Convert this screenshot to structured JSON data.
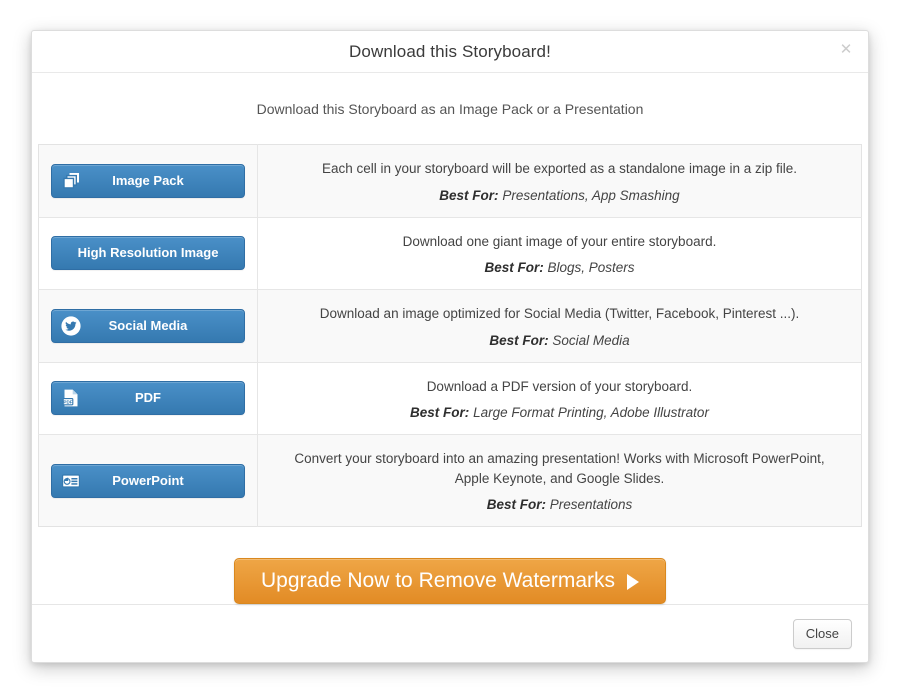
{
  "modal": {
    "title": "Download this Storyboard!",
    "close_icon": "close-icon",
    "subtitle": "Download this Storyboard as an Image Pack or a Presentation",
    "rows": [
      {
        "icon": "stacked-copies-icon",
        "button_label": "Image Pack",
        "description": "Each cell in your storyboard will be exported as a standalone image in a zip file.",
        "best_for_label": "Best For:",
        "best_for_value": "Presentations, App Smashing"
      },
      {
        "icon": "none",
        "button_label": "High Resolution Image",
        "description": "Download one giant image of your entire storyboard.",
        "best_for_label": "Best For:",
        "best_for_value": "Blogs, Posters"
      },
      {
        "icon": "twitter-bird-icon",
        "button_label": "Social Media",
        "description": "Download an image optimized for Social Media (Twitter, Facebook, Pinterest ...).",
        "best_for_label": "Best For:",
        "best_for_value": "Social Media"
      },
      {
        "icon": "pdf-file-icon",
        "button_label": "PDF",
        "description": "Download a PDF version of your storyboard.",
        "best_for_label": "Best For:",
        "best_for_value": "Large Format Printing, Adobe Illustrator"
      },
      {
        "icon": "presentation-slide-icon",
        "button_label": "PowerPoint",
        "description": "Convert your storyboard into an amazing presentation! Works with Microsoft PowerPoint, Apple Keynote, and Google Slides.",
        "best_for_label": "Best For:",
        "best_for_value": "Presentations"
      }
    ],
    "upgrade": {
      "label": "Upgrade Now to Remove Watermarks",
      "caret_icon": "play-caret-icon"
    },
    "footer": {
      "close_label": "Close"
    }
  },
  "colors": {
    "button_blue": "#3579b0",
    "button_blue_light": "#4a90c8",
    "upgrade_orange": "#e28b25",
    "upgrade_orange_light": "#efa646",
    "row_stripe": "#f9f9f9",
    "border": "#e3e3e3"
  }
}
